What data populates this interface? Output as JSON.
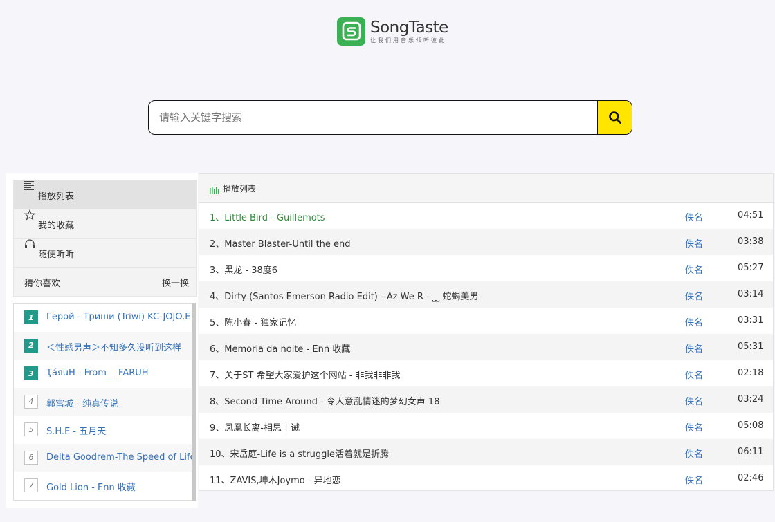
{
  "logo": {
    "name": "SongTaste",
    "slogan": "让我们用音乐倾听彼此",
    "brand_color": "#3cb054"
  },
  "search": {
    "placeholder": "请输入关键字搜索",
    "value": "",
    "button_icon": "search-icon",
    "button_color": "#ffe500"
  },
  "sidebar": {
    "menu": [
      {
        "label": "播放列表",
        "icon": "list-icon",
        "active": true
      },
      {
        "label": "我的收藏",
        "icon": "star-icon",
        "active": false
      },
      {
        "label": "随便听听",
        "icon": "headphones-icon",
        "active": false
      }
    ],
    "guess": {
      "title": "猜你喜欢",
      "refresh_label": "换一换"
    },
    "recommendations": [
      {
        "rank": "1",
        "title": "Герой - Триши (Triwi) KC-JOJO.E"
      },
      {
        "rank": "2",
        "title": "＜性感男声＞不知多久没听到这样"
      },
      {
        "rank": "3",
        "title": "ҬáяūН - From_ _FARUH"
      },
      {
        "rank": "4",
        "title": "郭富城 - 纯真传说"
      },
      {
        "rank": "5",
        "title": "S.H.E - 五月天"
      },
      {
        "rank": "6",
        "title": "Delta Goodrem-The Speed of Life"
      },
      {
        "rank": "7",
        "title": "Gold Lion - Enn 收藏"
      }
    ]
  },
  "playlist": {
    "header": "播放列表",
    "header_icon": "equalizer-icon",
    "playing_color": "#2f8a38",
    "songs": [
      {
        "title": "1、Little Bird - Guillemots",
        "artist": "佚名",
        "duration": "04:51",
        "playing": true
      },
      {
        "title": "2、Master Blaster-Until the end",
        "artist": "佚名",
        "duration": "03:38",
        "playing": false
      },
      {
        "title": "3、黑龙 - 38度6",
        "artist": "佚名",
        "duration": "05:27",
        "playing": false
      },
      {
        "title": "4、Dirty (Santos Emerson Radio Edit) - Az We R - ⎵⎵ 蛇蝎美男",
        "artist": "佚名",
        "duration": "03:14",
        "playing": false
      },
      {
        "title": "5、陈小春 - 独家记忆",
        "artist": "佚名",
        "duration": "03:31",
        "playing": false
      },
      {
        "title": "6、Memoria da noite - Enn 收藏",
        "artist": "佚名",
        "duration": "05:31",
        "playing": false
      },
      {
        "title": "7、关于ST 希望大家爱护这个网站 - 非我非非我",
        "artist": "佚名",
        "duration": "02:18",
        "playing": false
      },
      {
        "title": "8、Second Time Around - 令人意乱情迷的梦幻女声 18",
        "artist": "佚名",
        "duration": "03:24",
        "playing": false
      },
      {
        "title": "9、凤凰长离-相思十诫",
        "artist": "佚名",
        "duration": "05:08",
        "playing": false
      },
      {
        "title": "10、宋岳庭-Life is a struggle活着就是折腾",
        "artist": "佚名",
        "duration": "06:11",
        "playing": false
      },
      {
        "title": "11、ZAVIS,坤木Joymo - 异地恋",
        "artist": "佚名",
        "duration": "02:46",
        "playing": false
      }
    ]
  }
}
